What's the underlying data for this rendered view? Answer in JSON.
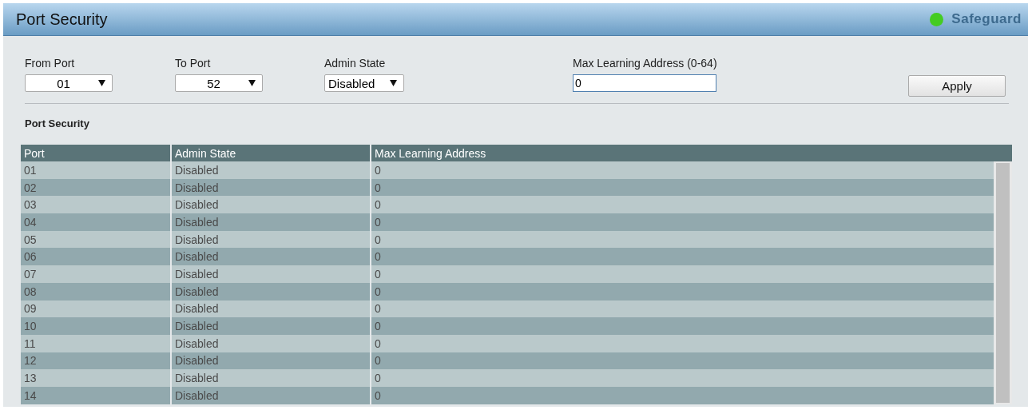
{
  "header": {
    "title": "Port Security",
    "status": {
      "label": "Safeguard",
      "color": "#44cc22"
    }
  },
  "form": {
    "fields": [
      {
        "kind": "select",
        "label": "From Port",
        "value": "01"
      },
      {
        "kind": "select",
        "label": "To Port",
        "value": "52"
      },
      {
        "kind": "select",
        "label": "Admin State",
        "value": "Disabled"
      },
      {
        "kind": "text",
        "label": "Max Learning Address (0-64)",
        "value": "0"
      }
    ],
    "button": "Apply"
  },
  "section_title": "Port Security",
  "table": {
    "columns": [
      "Port",
      "Admin State",
      "Max Learning Address"
    ],
    "rows": [
      [
        "01",
        "Disabled",
        "0"
      ],
      [
        "02",
        "Disabled",
        "0"
      ],
      [
        "03",
        "Disabled",
        "0"
      ],
      [
        "04",
        "Disabled",
        "0"
      ],
      [
        "05",
        "Disabled",
        "0"
      ],
      [
        "06",
        "Disabled",
        "0"
      ],
      [
        "07",
        "Disabled",
        "0"
      ],
      [
        "08",
        "Disabled",
        "0"
      ],
      [
        "09",
        "Disabled",
        "0"
      ],
      [
        "10",
        "Disabled",
        "0"
      ],
      [
        "11",
        "Disabled",
        "0"
      ],
      [
        "12",
        "Disabled",
        "0"
      ],
      [
        "13",
        "Disabled",
        "0"
      ],
      [
        "14",
        "Disabled",
        "0"
      ]
    ]
  }
}
